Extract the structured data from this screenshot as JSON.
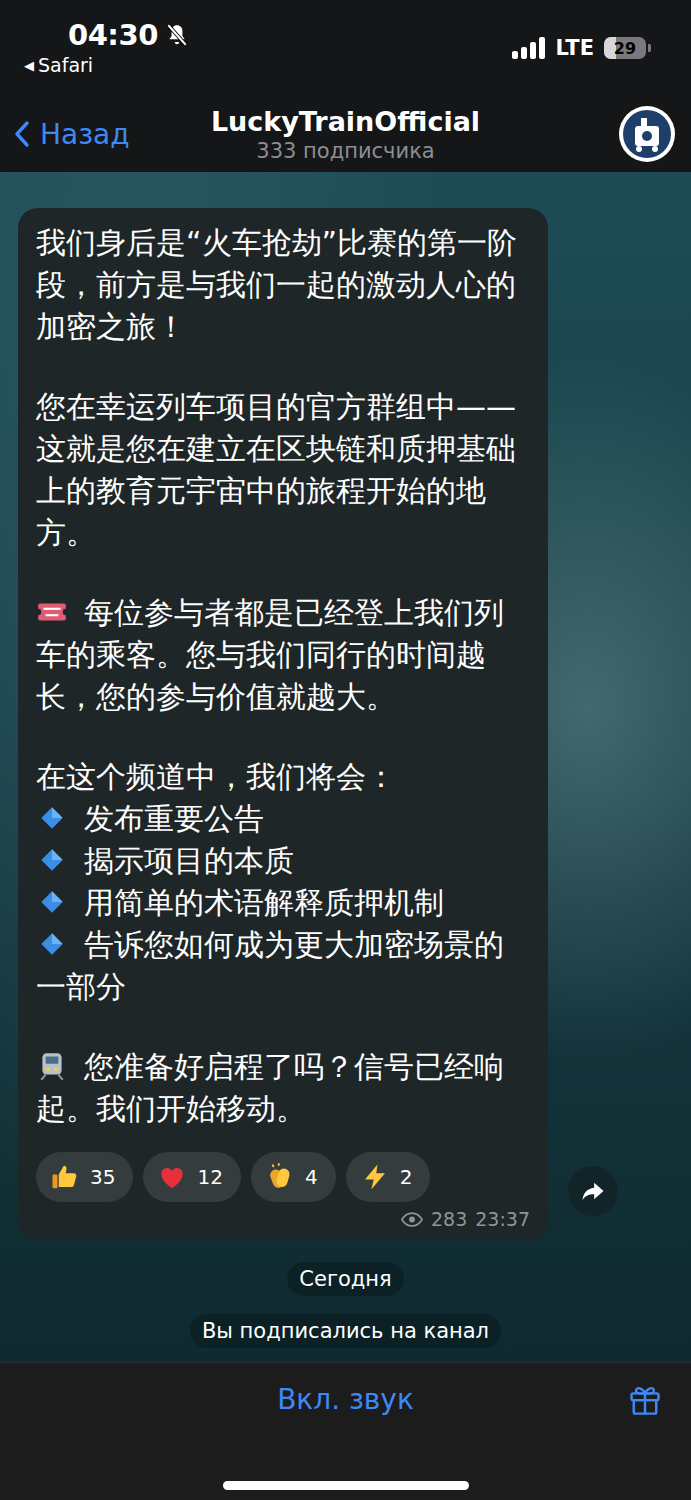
{
  "status_bar": {
    "time": "04:30",
    "muted": true,
    "back_icon": "◀",
    "back_app": "Safari",
    "signal_level": 1,
    "network": "LTE",
    "battery": "29",
    "battery_level": 0.29
  },
  "header": {
    "back": "Назад",
    "title": "LuckyTrainOfficial",
    "subtitle": "333 подписчика"
  },
  "message": {
    "paragraphs": [
      "我们身后是“火车抢劫”比赛的第一阶段，前方是与我们一起的激动人心的加密之旅！",
      "您在幸运列车项目的官方群组中——这就是您在建立在区块链和质押基础上的教育元宇宙中的旅程开始的地方。"
    ],
    "ticket_paragraph": "每位参与者都是已经登上我们列车的乘客。您与我们同行的时间越长，您的参与价值就越大。",
    "list_title": "在这个频道中，我们将会：",
    "list_items": [
      "发布重要公告",
      "揭示项目的本质",
      "用简单的术语解释质押机制",
      "告诉您如何成为更大加密场景的一部分"
    ],
    "closing": "您准备好启程了吗？信号已经响起。我们开始移动。",
    "reactions": [
      {
        "kind": "thumbs-up",
        "count": "35",
        "selected": false
      },
      {
        "kind": "heart",
        "count": "12",
        "selected": false
      },
      {
        "kind": "clap",
        "count": "4",
        "selected": false
      },
      {
        "kind": "lightning",
        "count": "2",
        "selected": false
      }
    ],
    "views": "283",
    "time": "23:37"
  },
  "date_pill": "Сегодня",
  "service_message": "Вы подписались на канал",
  "bottom_bar": {
    "button": "Вкл. звук"
  }
}
